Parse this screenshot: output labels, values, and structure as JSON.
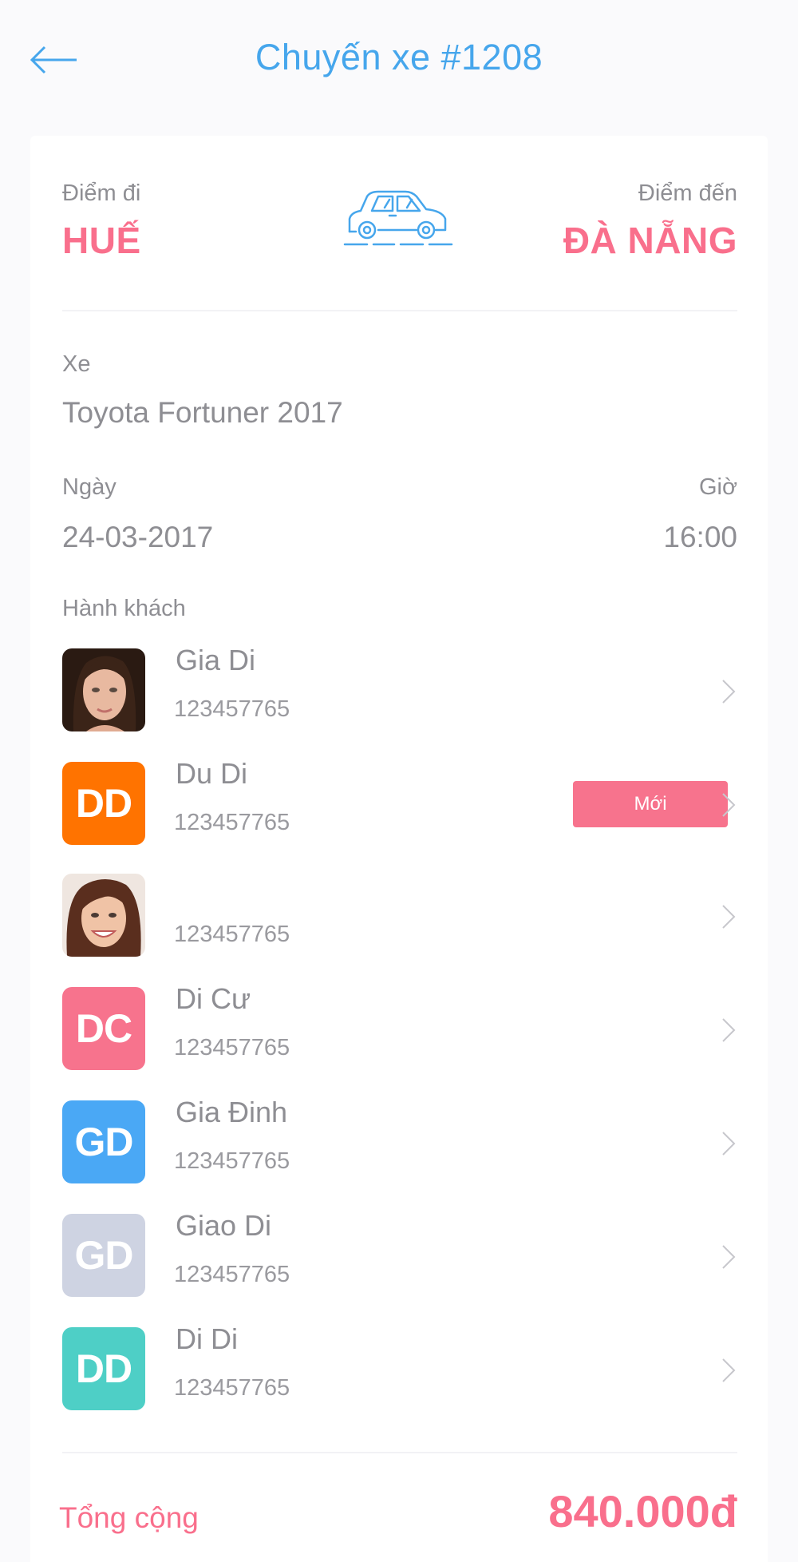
{
  "header": {
    "title": "Chuyến xe #1208"
  },
  "trip": {
    "from_label": "Điểm đi",
    "from_city": "HUẾ",
    "to_label": "Điểm đến",
    "to_city": "ĐÀ NẴNG",
    "vehicle_label": "Xe",
    "vehicle_value": "Toyota Fortuner 2017",
    "date_label": "Ngày",
    "date_value": "24-03-2017",
    "time_label": "Giờ",
    "time_value": "16:00",
    "passengers_label": "Hành khách"
  },
  "passengers": [
    {
      "name": "Gia Di",
      "phone": "123457765",
      "avatar": "photo"
    },
    {
      "name": "Du Di",
      "phone": "123457765",
      "initials": "DD",
      "color": "#ff7300",
      "badge": "Mới"
    },
    {
      "name": "",
      "phone": "123457765",
      "avatar": "photo"
    },
    {
      "name": "Di Cư",
      "phone": "123457765",
      "initials": "DC",
      "color": "#f7738d"
    },
    {
      "name": "Gia Đinh",
      "phone": "123457765",
      "initials": "GD",
      "color": "#4aa8f5"
    },
    {
      "name": "Giao Di",
      "phone": "123457765",
      "initials": "GD",
      "color": "#ced3e2"
    },
    {
      "name": "Di Di",
      "phone": "123457765",
      "initials": "DD",
      "color": "#4ecfc6"
    }
  ],
  "summary": {
    "total_label": "Tổng cộng",
    "total_value": "840.000đ"
  },
  "colors": {
    "accent_blue": "#46a6ec",
    "accent_pink": "#f96f8c",
    "text_gray": "#8e8e93"
  },
  "icons": {
    "back": "arrow-left-icon",
    "vehicle": "car-icon",
    "row": "chevron-right-icon"
  }
}
